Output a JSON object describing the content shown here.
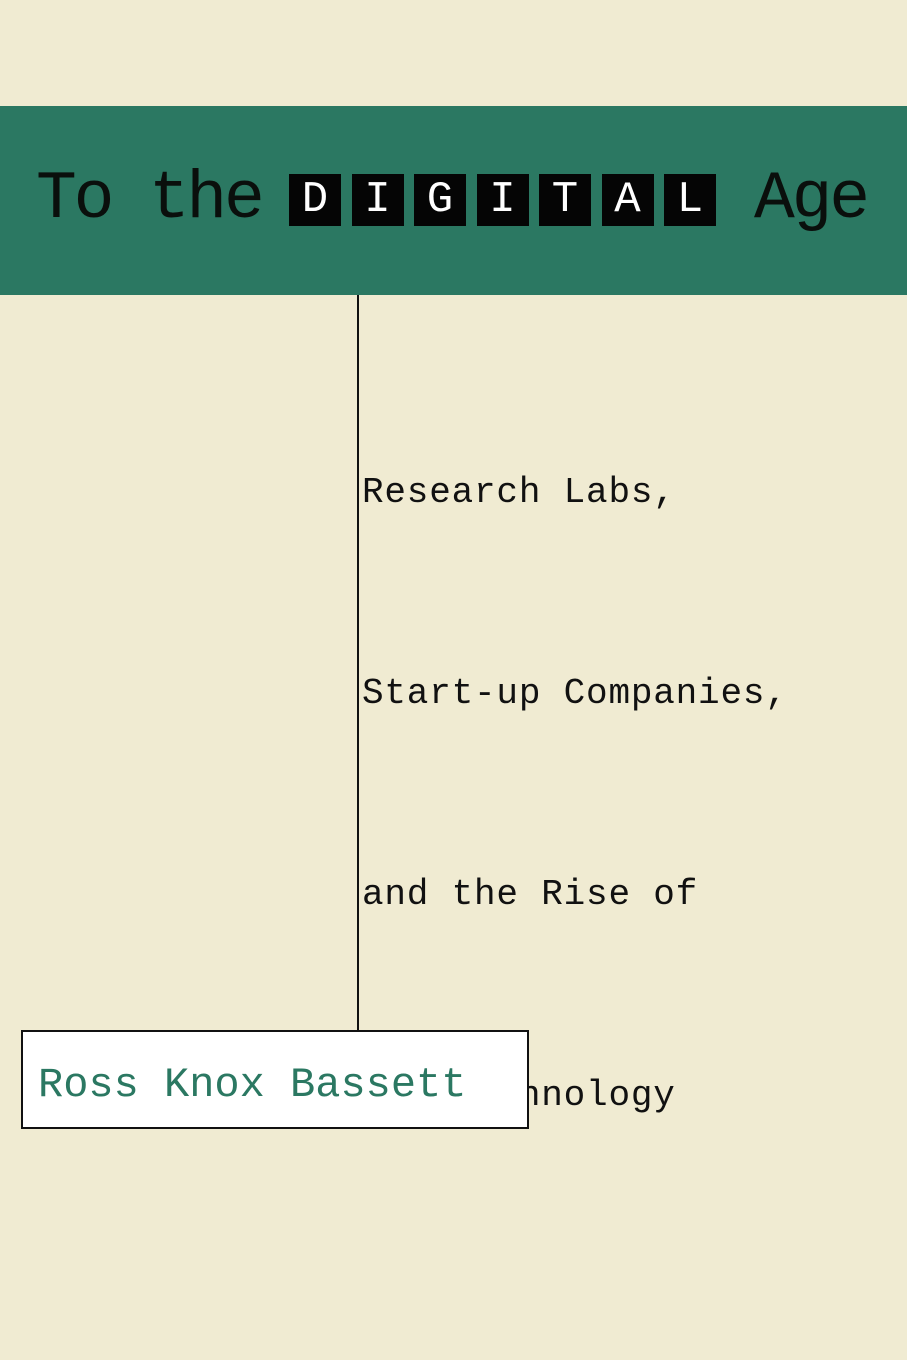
{
  "cover": {
    "title": {
      "prefix": "To the",
      "highlight_letters": [
        "D",
        "I",
        "G",
        "I",
        "T",
        "A",
        "L"
      ],
      "suffix": "Age"
    },
    "subtitle_lines": [
      "Research Labs,",
      "Start-up Companies,",
      "and the Rise of",
      "MOS Technology"
    ],
    "author": "Ross Knox Bassett",
    "colors": {
      "background": "#f0ebd2",
      "band": "#2b7862",
      "letter_box": "#050505",
      "author_text": "#2b7862"
    }
  }
}
